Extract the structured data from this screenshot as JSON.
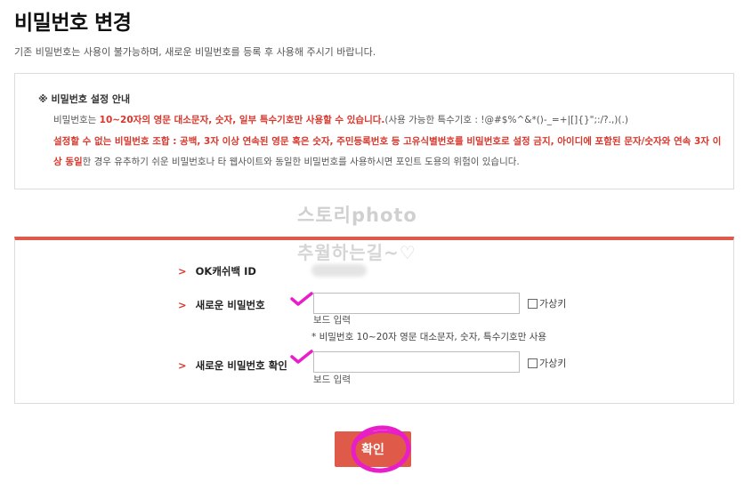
{
  "header": {
    "title": "비밀번호 변경",
    "subtitle": "기존 비밀번호는 사용이 불가능하며, 새로운 비밀번호를 등록 후 사용해 주시기 바랍니다."
  },
  "guide": {
    "heading": "※ 비밀번호 설정 안내",
    "line1_prefix": "비밀번호는 ",
    "line1_red": "10~20자의 영문 대소문자, 숫자, 일부 특수기호만 사용할 수 있습니다.",
    "line1_suffix": "(사용 가능한 특수기호 : !@#$%^&*()-_=+|[]{}\";:/?.,)(.)",
    "line2_red": "설정할 수 없는 비밀번호 조합 : 공백, 3자 이상 연속된 영문 혹은 숫자, 주민등록번호 등 고유식별번호를 비밀번호로 설정 금지, 아이디에 포함된 문자/숫자와 연속 3자 이",
    "line3_red": "상 동일",
    "line3_suffix": "한 경우 유추하기 쉬운 비밀번호나 타 웹사이트와 동일한 비밀번호를 사용하시면 포인트 도용의 위험이 있습니다."
  },
  "watermark": {
    "line1": "스토리photo",
    "line2": "추월하는길~♡"
  },
  "form": {
    "chevron": ">",
    "id_label": "OK캐쉬백 ID",
    "new_pw_label": "새로운 비밀번호",
    "new_pw_value": "",
    "confirm_pw_label": "새로운 비밀번호 확인",
    "confirm_pw_value": "",
    "virtual_keyboard": "가상키",
    "keyboard_input_hint": "보드 입력",
    "pw_rule_note": "* 비밀번호 10~20자 영문 대소문자, 숫자, 특수기호만 사용"
  },
  "actions": {
    "confirm_label": "확인"
  },
  "colors": {
    "accent": "#e05a4a",
    "highlight": "#e81ec8"
  }
}
